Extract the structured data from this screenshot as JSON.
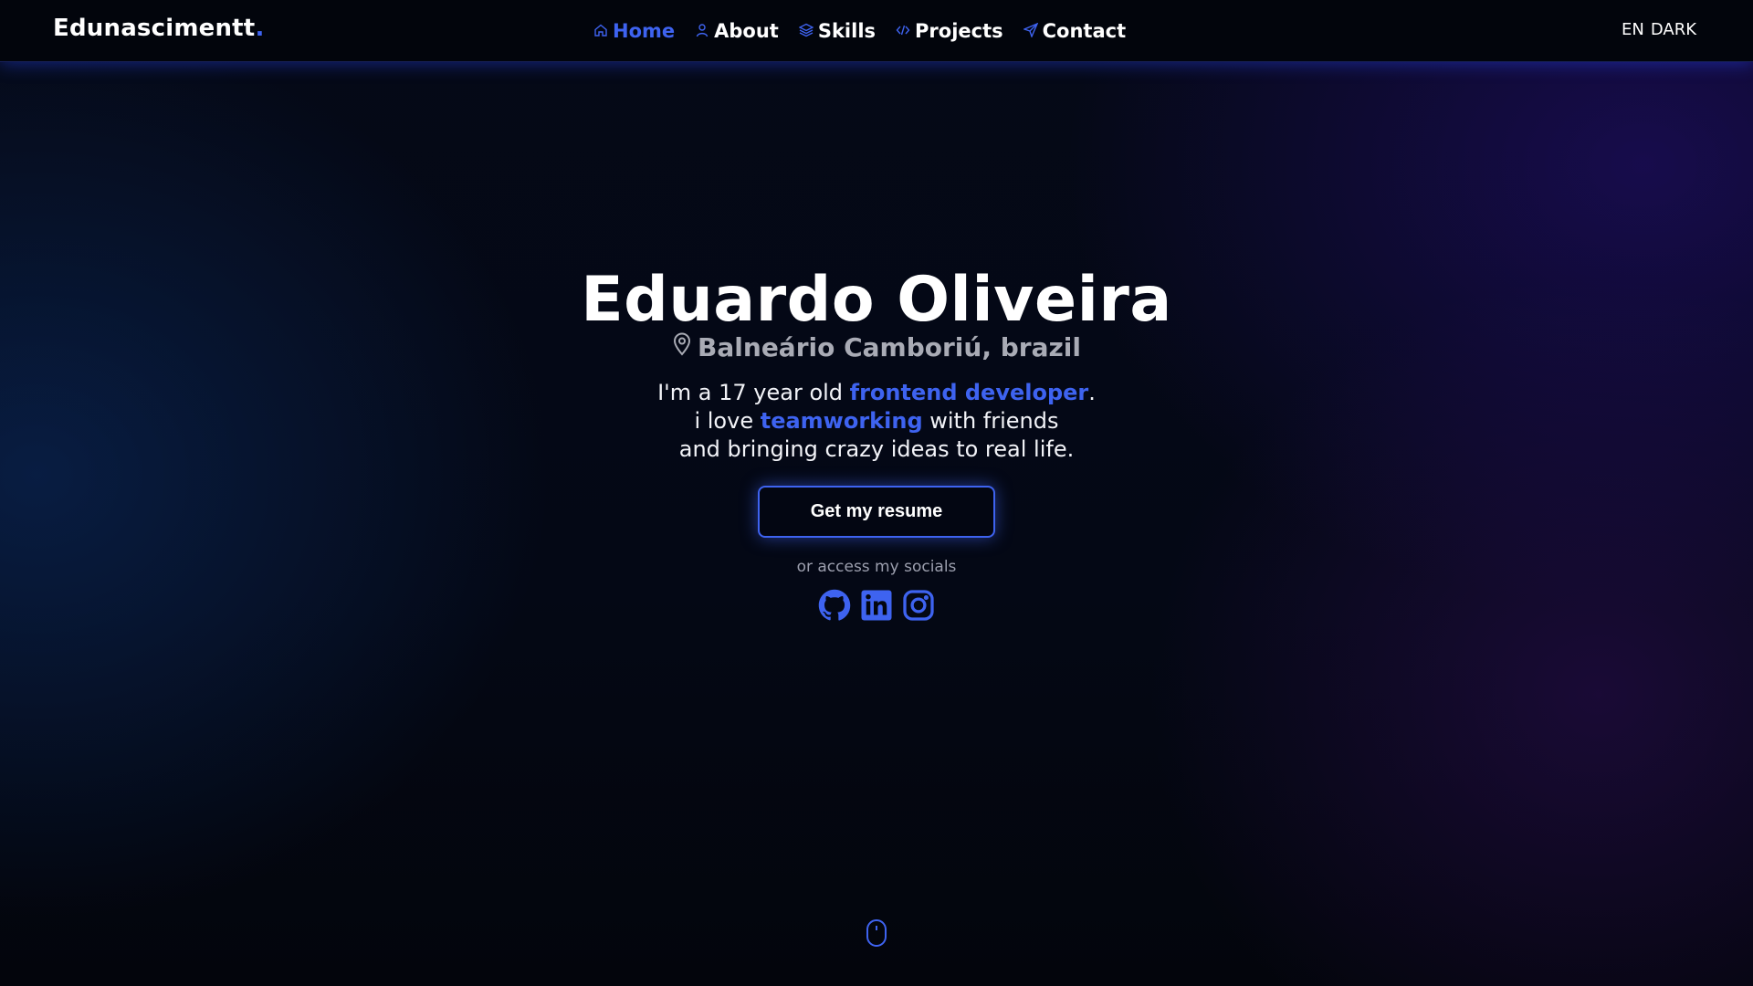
{
  "header": {
    "logo_text": "Edunascimentt",
    "logo_dot": ".",
    "nav": [
      {
        "label": "Home",
        "icon": "home-icon",
        "active": true
      },
      {
        "label": "About",
        "icon": "user-icon",
        "active": false
      },
      {
        "label": "Skills",
        "icon": "layers-icon",
        "active": false
      },
      {
        "label": "Projects",
        "icon": "code-icon",
        "active": false
      },
      {
        "label": "Contact",
        "icon": "send-icon",
        "active": false
      }
    ],
    "language": "EN",
    "theme": "DARK"
  },
  "hero": {
    "name": "Eduardo Oliveira",
    "location": "Balneário Camboriú, brazil",
    "bio": {
      "line1_before": "I'm a 17 year old ",
      "line1_highlight": "frontend developer",
      "line1_after": ".",
      "line2_before": "i love ",
      "line2_highlight": "teamworking",
      "line2_after": " with friends",
      "line3": "and bringing crazy ideas to real life."
    },
    "resume_button": "Get my resume",
    "socials_label": "or access my socials",
    "socials": [
      "github-icon",
      "linkedin-icon",
      "instagram-icon"
    ]
  },
  "colors": {
    "accent": "#3e63f0",
    "background": "#03060f",
    "muted_text": "#a9abb5"
  }
}
